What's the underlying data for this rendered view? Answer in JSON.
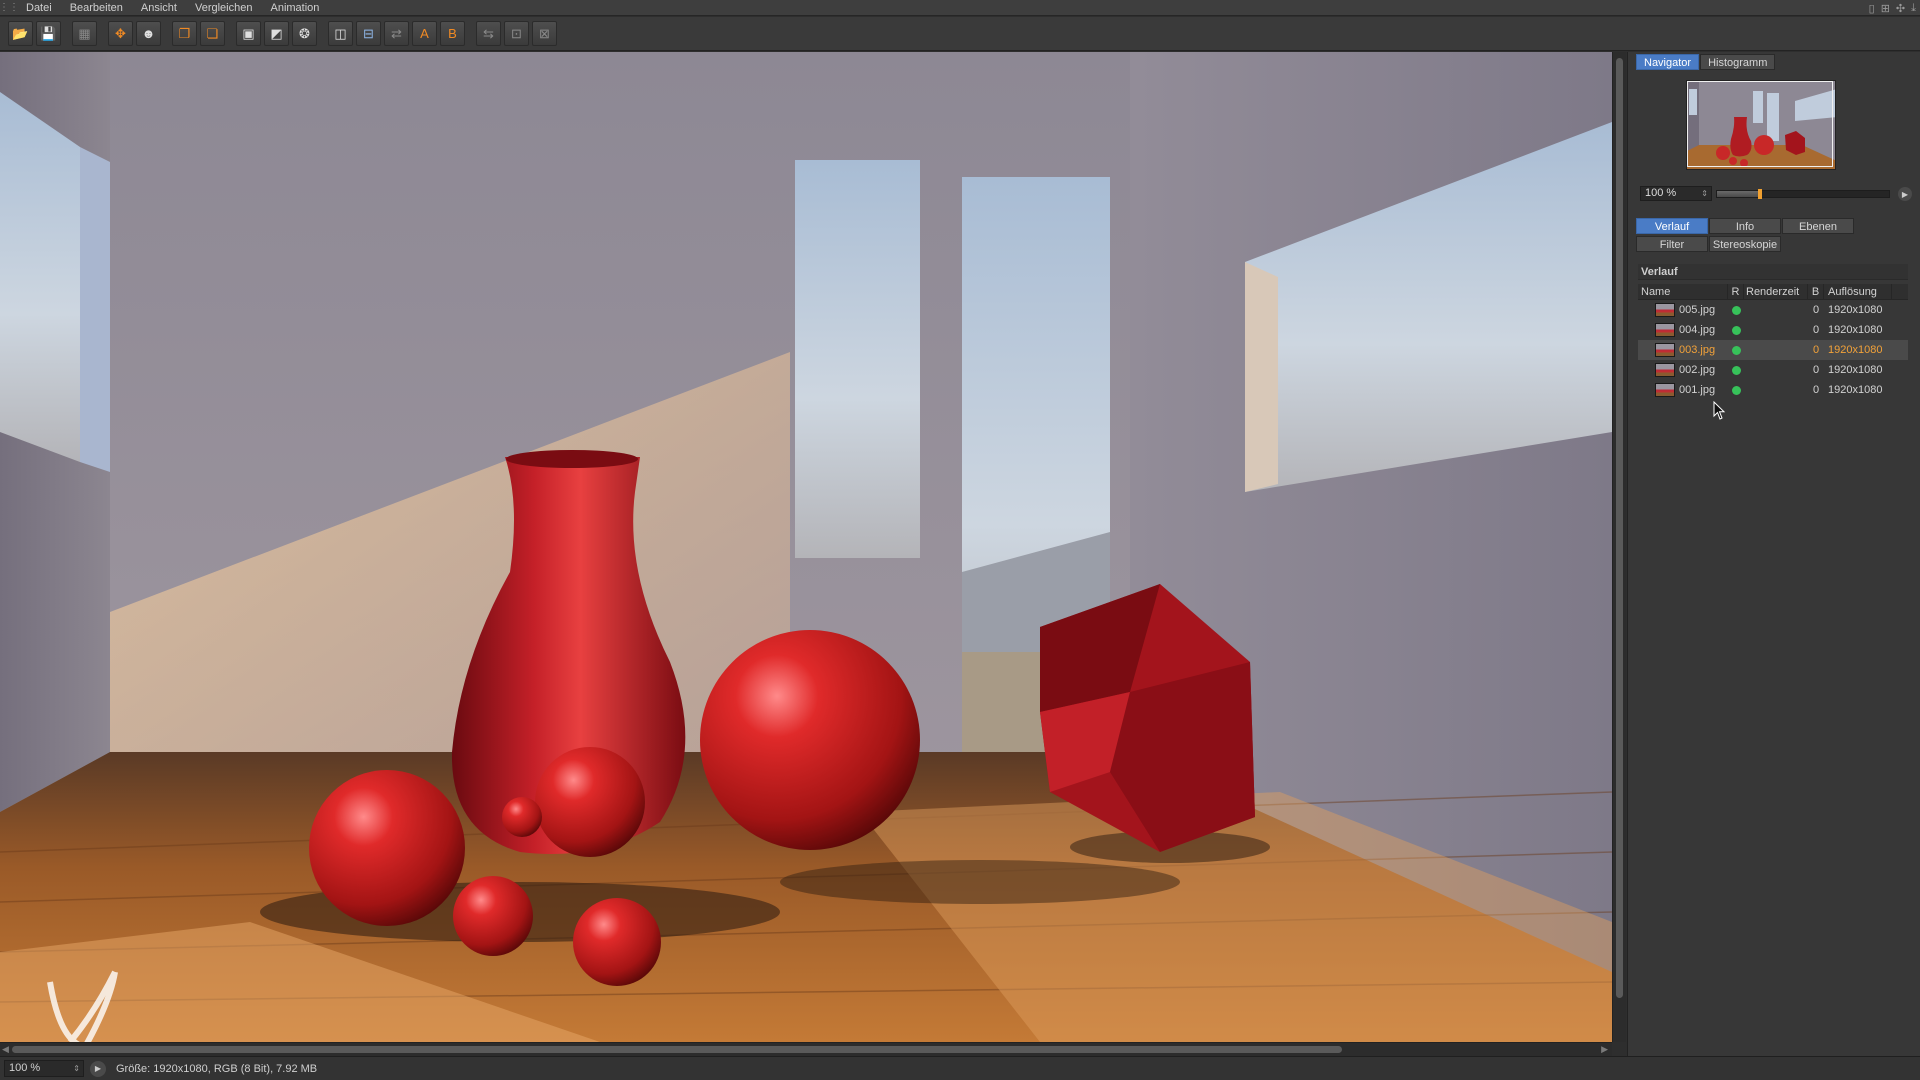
{
  "menubar": {
    "items": [
      "Datei",
      "Bearbeiten",
      "Ansicht",
      "Vergleichen",
      "Animation"
    ]
  },
  "toolbar": {
    "buttons": [
      {
        "icon": "open-folder-icon"
      },
      {
        "icon": "save-icon"
      },
      {
        "icon": "grid-icon"
      },
      {
        "icon": "move-icon"
      },
      {
        "icon": "user-icon"
      },
      {
        "icon": "copy-icon"
      },
      {
        "icon": "paste-icon"
      },
      {
        "icon": "render-region-icon"
      },
      {
        "icon": "render-view-icon"
      },
      {
        "icon": "render-settings-icon"
      },
      {
        "icon": "compare-ab-icon"
      },
      {
        "icon": "split-view-icon"
      },
      {
        "icon": "text-ab-icon"
      },
      {
        "icon": "set-a-icon"
      },
      {
        "icon": "set-b-icon"
      },
      {
        "icon": "swap-icon"
      },
      {
        "icon": "layout-icon"
      },
      {
        "icon": "layout2-icon"
      }
    ]
  },
  "viewport": {
    "description_colors": {
      "wall": "#8a8490",
      "floor": "#b06a2c",
      "red": "#c82828",
      "sky": "#b8c8dc"
    }
  },
  "statusbar": {
    "zoom": "100 %",
    "info": "Größe: 1920x1080, RGB (8 Bit), 7.92 MB"
  },
  "panel": {
    "top_tabs": [
      "Navigator",
      "Histogramm"
    ],
    "nav_zoom": "100 %",
    "nav_zoom_fraction": 0.24,
    "mid_tabs_row1": [
      "Verlauf",
      "Info",
      "Ebenen"
    ],
    "mid_tabs_row2": [
      "Filter",
      "Stereoskopie"
    ],
    "section_title": "Verlauf",
    "table": {
      "headers": {
        "name": "Name",
        "r": "R",
        "rendertime": "Renderzeit",
        "b": "B",
        "res": "Auflösung"
      },
      "rows": [
        {
          "name": "005.jpg",
          "b": "0",
          "res": "1920x1080",
          "selected": false
        },
        {
          "name": "004.jpg",
          "b": "0",
          "res": "1920x1080",
          "selected": false
        },
        {
          "name": "003.jpg",
          "b": "0",
          "res": "1920x1080",
          "selected": true
        },
        {
          "name": "002.jpg",
          "b": "0",
          "res": "1920x1080",
          "selected": false
        },
        {
          "name": "001.jpg",
          "b": "0",
          "res": "1920x1080",
          "selected": false
        }
      ]
    }
  },
  "colors": {
    "accent": "#4a7cc6",
    "selected_text": "#f2a23a",
    "status_green": "#37c25a"
  }
}
